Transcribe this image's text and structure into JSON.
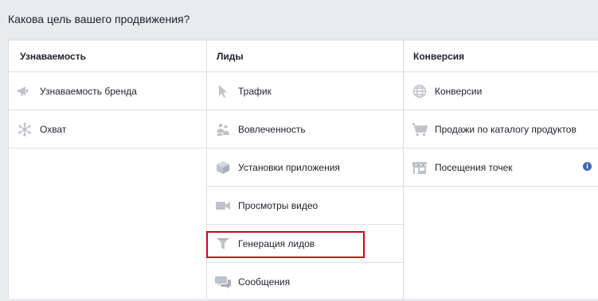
{
  "header": {
    "title": "Какова цель вашего продвижения?"
  },
  "columns": [
    {
      "title": "Узнаваемость",
      "items": [
        {
          "label": "Узнаваемость бренда",
          "icon": "megaphone-icon"
        },
        {
          "label": "Охват",
          "icon": "reach-snowflake-icon"
        }
      ]
    },
    {
      "title": "Лиды",
      "items": [
        {
          "label": "Трафик",
          "icon": "cursor-icon"
        },
        {
          "label": "Вовлеченность",
          "icon": "people-icon"
        },
        {
          "label": "Установки приложения",
          "icon": "box-icon"
        },
        {
          "label": "Просмотры видео",
          "icon": "video-camera-icon"
        },
        {
          "label": "Генерация лидов",
          "icon": "funnel-icon"
        },
        {
          "label": "Сообщения",
          "icon": "chat-bubbles-icon"
        }
      ]
    },
    {
      "title": "Конверсия",
      "items": [
        {
          "label": "Конверсии",
          "icon": "globe-icon"
        },
        {
          "label": "Продажи по каталогу продуктов",
          "icon": "shopping-cart-icon"
        },
        {
          "label": "Посещения точек",
          "icon": "store-icon",
          "info_icon": "info-icon",
          "info_text": "i"
        }
      ]
    }
  ],
  "colors": {
    "icon_gray": "#bec2c9",
    "info_blue": "#4267b2",
    "highlight_red": "#d0021b",
    "border": "#dddfe2",
    "page_bg": "#e9ebee"
  }
}
